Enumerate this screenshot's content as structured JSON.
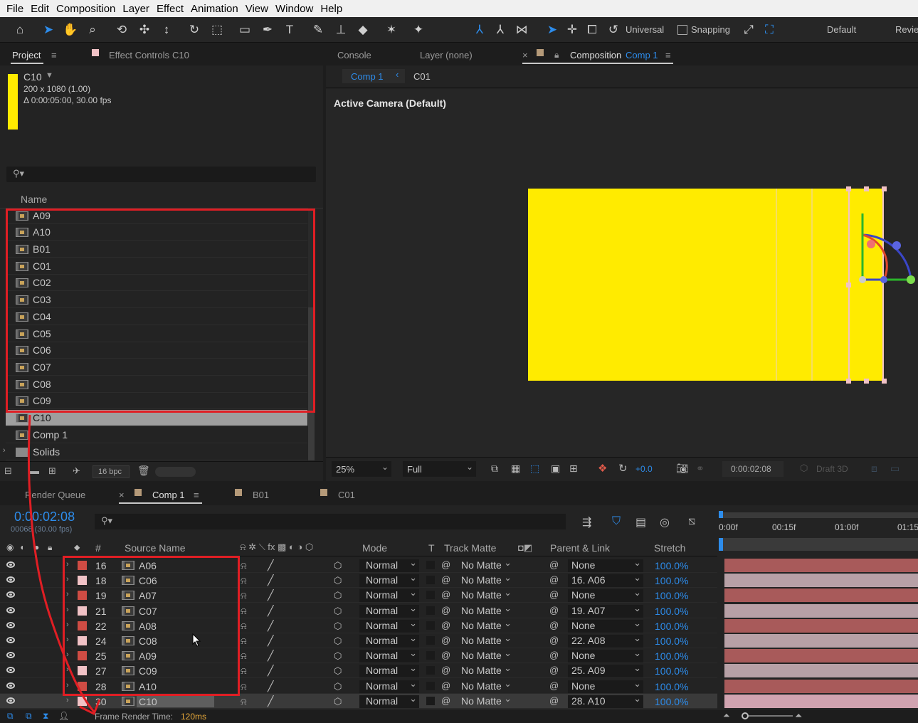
{
  "menu": [
    "File",
    "Edit",
    "Composition",
    "Layer",
    "Effect",
    "Animation",
    "View",
    "Window",
    "Help"
  ],
  "toolbar": {
    "universal_label": "Universal",
    "snapping_label": "Snapping",
    "workspace_default": "Default",
    "workspace_review": "Revie"
  },
  "project_panel": {
    "tab_project": "Project",
    "tab_effect_controls": "Effect Controls",
    "effect_controls_target": "C10",
    "selected_item": {
      "name": "C10",
      "dimensions": "200 x 1080 (1.00)",
      "duration": "Δ 0:00:05:00, 30.00 fps"
    },
    "column_name": "Name",
    "items": [
      "A09",
      "A10",
      "B01",
      "C01",
      "C02",
      "C03",
      "C04",
      "C05",
      "C06",
      "C07",
      "C08",
      "C09",
      "C10",
      "Comp 1",
      "Solids"
    ],
    "bit_depth": "16 bpc"
  },
  "composition_panel": {
    "tab_console": "Console",
    "tab_layer": "Layer (none)",
    "tab_composition": "Composition",
    "tab_composition_name": "Comp 1",
    "breadcrumb_comp": "Comp 1",
    "breadcrumb_sub": "C01",
    "camera_label": "Active Camera (Default)",
    "zoom": "25%",
    "resolution": "Full",
    "exposure": "+0.0",
    "timecode": "0:00:02:08",
    "renderer": "Draft 3D",
    "solid_color": "#ffeb00"
  },
  "timeline": {
    "tab_render_queue": "Render Queue",
    "tab_comp": "Comp 1",
    "tab_b01": "B01",
    "tab_c01": "C01",
    "current_time": "0:00:02:08",
    "frame_info": "00068 (30.00 fps)",
    "columns": {
      "num": "#",
      "source_name": "Source Name",
      "mode": "Mode",
      "t": "T",
      "track_matte": "Track Matte",
      "parent_link": "Parent & Link",
      "stretch": "Stretch"
    },
    "ruler": [
      "0:00f",
      "00:15f",
      "01:00f",
      "01:15"
    ],
    "layers": [
      {
        "num": "16",
        "name": "A06",
        "label_color": "#cf4c44",
        "mode": "Normal",
        "matte": "No Matte",
        "parent": "None",
        "stretch": "100.0%"
      },
      {
        "num": "18",
        "name": "C06",
        "label_color": "#f1c2c6",
        "mode": "Normal",
        "matte": "No Matte",
        "parent": "16. A06",
        "stretch": "100.0%"
      },
      {
        "num": "19",
        "name": "A07",
        "label_color": "#cf4c44",
        "mode": "Normal",
        "matte": "No Matte",
        "parent": "None",
        "stretch": "100.0%"
      },
      {
        "num": "21",
        "name": "C07",
        "label_color": "#f1c2c6",
        "mode": "Normal",
        "matte": "No Matte",
        "parent": "19. A07",
        "stretch": "100.0%"
      },
      {
        "num": "22",
        "name": "A08",
        "label_color": "#cf4c44",
        "mode": "Normal",
        "matte": "No Matte",
        "parent": "None",
        "stretch": "100.0%"
      },
      {
        "num": "24",
        "name": "C08",
        "label_color": "#f1c2c6",
        "mode": "Normal",
        "matte": "No Matte",
        "parent": "22. A08",
        "stretch": "100.0%"
      },
      {
        "num": "25",
        "name": "A09",
        "label_color": "#cf4c44",
        "mode": "Normal",
        "matte": "No Matte",
        "parent": "None",
        "stretch": "100.0%"
      },
      {
        "num": "27",
        "name": "C09",
        "label_color": "#f1c2c6",
        "mode": "Normal",
        "matte": "No Matte",
        "parent": "25. A09",
        "stretch": "100.0%"
      },
      {
        "num": "28",
        "name": "A10",
        "label_color": "#cf4c44",
        "mode": "Normal",
        "matte": "No Matte",
        "parent": "None",
        "stretch": "100.0%"
      },
      {
        "num": "30",
        "name": "C10",
        "label_color": "#f1c2c6",
        "mode": "Normal",
        "matte": "No Matte",
        "parent": "28. A10",
        "stretch": "100.0%"
      }
    ],
    "frame_render_label": "Frame Render Time:",
    "frame_render_value": "120ms"
  },
  "colors": {
    "accent_blue": "#2d8ceb",
    "annotation_red": "#e01e24",
    "bar_red": "#a85a5a",
    "bar_pink": "#b7a0a6"
  }
}
